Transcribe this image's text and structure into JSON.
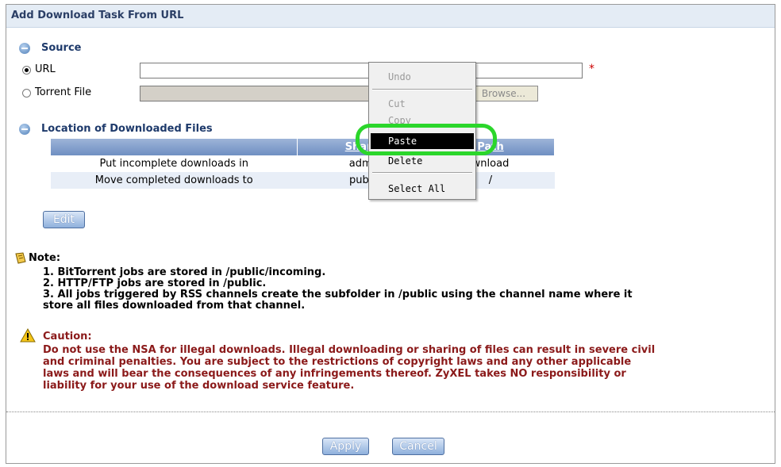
{
  "title": "Add Download Task From URL",
  "source": {
    "heading": "Source",
    "url_label": "URL",
    "url_value": "",
    "torrent_label": "Torrent File",
    "browse_label": "Browse...",
    "required_mark": "*"
  },
  "location": {
    "heading": "Location of Downloaded Files",
    "columns": [
      "",
      "Share",
      "Path"
    ],
    "rows": [
      {
        "label": "Put incomplete downloads in",
        "share": "admi",
        "path": "wnload"
      },
      {
        "label": "Move completed downloads to",
        "share": "publi",
        "path": "/"
      }
    ],
    "edit_label": "Edit"
  },
  "note": {
    "heading": "Note:",
    "lines": [
      "1. BitTorrent jobs are stored in /public/incoming.",
      "2. HTTP/FTP jobs are stored in /public.",
      "3. All jobs triggered by RSS channels create the subfolder in /public using the channel name where it",
      "store all files downloaded from that channel."
    ]
  },
  "caution": {
    "heading": "Caution:",
    "lines": [
      "Do not use the NSA for illegal downloads. Illegal downloading or sharing of files can result in severe civil",
      "and criminal penalties. You are subject to the restrictions of copyright laws and any other applicable",
      "laws and will bear the consequences of any infringements thereof. ZyXEL takes NO responsibility or",
      "liability for your use of the download service feature."
    ]
  },
  "buttons": {
    "apply": "Apply",
    "cancel": "Cancel"
  },
  "context_menu": {
    "undo": "Undo",
    "cut": "Cut",
    "copy": "Copy",
    "paste": "Paste",
    "delete": "Delete",
    "select_all": "Select All"
  },
  "colors": {
    "highlight": "#2bd62b",
    "title_text": "#2b3f66",
    "caution_text": "#8b1a1a"
  }
}
